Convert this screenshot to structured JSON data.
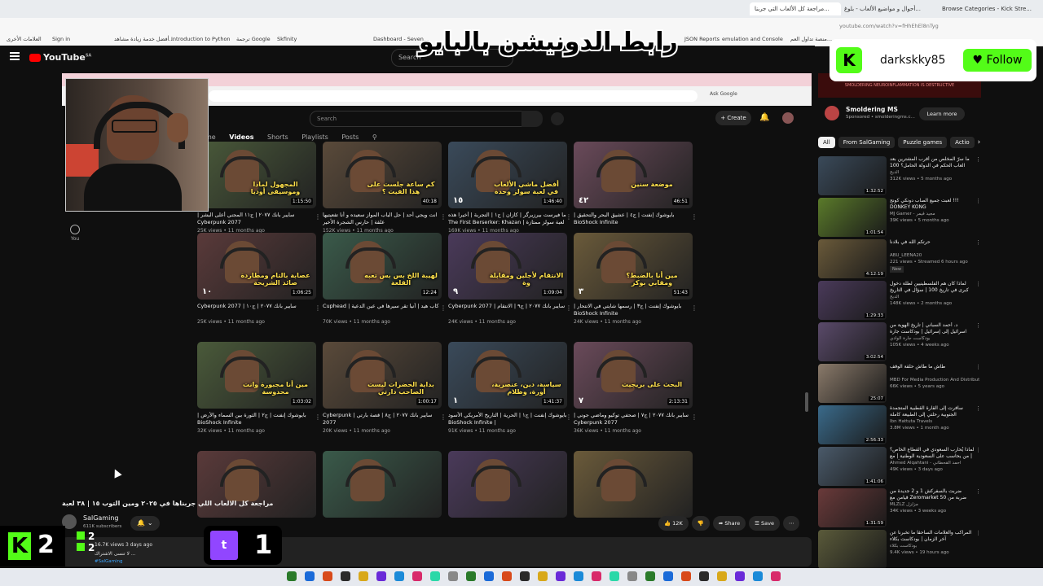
{
  "browser": {
    "tabs": [
      {
        "title": "مراجعة كل الألعاب التي جربنا...",
        "active": false
      },
      {
        "title": "أحوال و مواضيع الألعاب - بلوغ...",
        "active": false
      },
      {
        "title": "Browse Categories - Kick Stre...",
        "active": false
      }
    ],
    "url": "youtube.com/watch?v=fHhEhEl8nTyg",
    "bookmarks": [
      "Sign in",
      "أفضل خدمة زيادة مشاهد...",
      "Introduction to Python",
      "ترجمة Google",
      "Skfinity",
      "...",
      "Dashboard - Seven...",
      "JSON Reports",
      "ترجمة Google",
      "emulation and Console",
      "منصة تداول العم...",
      "كل الإشارات المرجعية",
      "العلامات الأخرى"
    ]
  },
  "youtube": {
    "logo": "YouTube",
    "logo_region": "SA",
    "search_placeholder": "Search"
  },
  "overlay": {
    "banner_text": "رابط الدونيشن بالبايو",
    "kick_username": "darkskky85",
    "kick_follow": "Follow",
    "kick_count": "2",
    "mini_counts": [
      "2",
      "2"
    ],
    "twitch_count": "1",
    "colors": {
      "kick": "#53fc18",
      "twitch": "#9146ff"
    }
  },
  "inner": {
    "ask_label": "Ask Google",
    "search_placeholder": "Search",
    "create_label": "Create",
    "channel_tabs": [
      "me",
      "Videos",
      "Shorts",
      "Playlists",
      "Posts"
    ],
    "active_tab": "Videos",
    "you_label": "You",
    "videos": [
      {
        "title": "سايبر بانك ٢٠٧٧ | ج١١ المجني أعلى البشر | Cyberpunk 2077",
        "meta": "25K views • 11 months ago",
        "caption": "المجهول لماذا وموسيقى أوديا",
        "num": "",
        "duration": "1:15:50"
      },
      {
        "title": "انت ويجي أحد | حل الباب المواز سعيده و أنا تفعيتيها علقة | حارس الشجرة الأخير",
        "meta": "152K views • 11 months ago",
        "caption": "كم ساعة جلست على هذا الفيت ؟",
        "num": "",
        "duration": "40:18"
      },
      {
        "title": "ما فيرست بيرزيرگر | كازان | ج١ | التجربة | أخيرا هذه لعبة سولز ممتازة | The First Berserker: Khazan",
        "meta": "169K views • 11 months ago",
        "caption": "أفضل ماشي الألعاب في لعبة سولز وحدة",
        "num": "١٥",
        "duration": "1:46:40"
      },
      {
        "title": "بايوشوك إنفنت | ج٤ | عشيق البحر والتحقيق | BioShock Infinite",
        "meta": "",
        "caption": "موضعة سنين",
        "num": "٤٢",
        "duration": "46:51"
      },
      {
        "title": "سايبر بانك ٢٠٧٧ | ج١٠ | Cyberpunk 2077",
        "meta": "25K views • 11 months ago",
        "caption": "عصابة بالتام ومطاردة صائد الشريحة",
        "num": "١٠",
        "duration": "1:06:25"
      },
      {
        "title": "كاب هيد | أنيا تقر سيرها في عين الدعية | Cuphead",
        "meta": "70K views • 11 months ago",
        "caption": "لهيبة اللخ بس بس تعبه القلعة",
        "num": "",
        "duration": "12:24"
      },
      {
        "title": "سايبر بانك ٢٠٧٧ | ج٩ | الانتقام | Cyberpunk 2077",
        "meta": "24K views • 11 months ago",
        "caption": "الانتقام لأجلين ومقابلة وة",
        "num": "٩",
        "duration": "1:09:04"
      },
      {
        "title": "بايوشوك إنفنت | ج٣ | رسمها شايتي في الانتحار | BioShock Infinite",
        "meta": "24K views • 11 months ago",
        "caption": "مين أنا بالضبط؟ ومقابي بوكر",
        "num": "٣",
        "duration": "51:43"
      },
      {
        "title": "بايوشوك إنفنت | ج٢ | الثورة بين السماء والأرض | BioShock Infinite",
        "meta": "32K views • 11 months ago",
        "caption": "مين أنا مجبورة وانت محدوسة",
        "num": "",
        "duration": "1:03:02"
      },
      {
        "title": "سايبر بانك ٢٠٧٧ | ج٨ | قصة بارتي | Cyberpunk 2077",
        "meta": "20K views • 11 months ago",
        "caption": "بداية الحضرات ليست الصاحب دارتي",
        "num": "",
        "duration": "1:00:17"
      },
      {
        "title": "بايوشوك إنفنت | ج١ | الحرية | التاريخ الأمريكي الأسود | BioShock Infinite",
        "meta": "91K views • 11 months ago",
        "caption": "سياسة، دين، عنصرية، أورة، وظلام",
        "num": "١",
        "duration": "1:41:37"
      },
      {
        "title": "سايبر بانك ٢٠٧٧ | ج٧ | صحفي توكيو وماضي جوني | Cyberpunk 2077",
        "meta": "36K views • 11 months ago",
        "caption": "البحث على بريجيت",
        "num": "٧",
        "duration": "2:13:31"
      },
      {
        "title": "",
        "meta": "",
        "caption": "",
        "num": "",
        "duration": ""
      },
      {
        "title": "",
        "meta": "",
        "caption": "",
        "num": "",
        "duration": ""
      },
      {
        "title": "",
        "meta": "",
        "caption": "",
        "num": "",
        "duration": ""
      },
      {
        "title": "",
        "meta": "",
        "caption": "",
        "num": "",
        "duration": ""
      }
    ]
  },
  "ad": {
    "image_text": "SMOLDERING NEUROINFLAMMATION IS DESTRUCTIVE",
    "title": "Smoldering MS",
    "sponsor": "Sponsored • smolderingms.c...",
    "learn_more": "Learn more"
  },
  "chips": [
    "All",
    "From SalGaming",
    "Puzzle games",
    "Actio"
  ],
  "sidebar": [
    {
      "title": "ما سرّ المخلص من أقرب المشترين بعد العاب الحكم في الدولة الحامل؟ 100 سؤال في",
      "channel": "الدبح",
      "meta": "312K views • 5 months ago",
      "duration": "1:32:52",
      "badge": "",
      "color": "#3a4a5a"
    },
    {
      "title": "لعبت جميع الصاب دونكي كونج !!! DONKEY KONG",
      "channel": "MJ Gamer - مجيد قيمر",
      "meta": "39K views • 5 months ago",
      "duration": "1:01:54",
      "badge": "",
      "color": "#5a7a2a"
    },
    {
      "title": "حرتكم الله في بلادنا",
      "channel": "ABU_LEENA20",
      "meta": "221 views • Streamed 6 hours ago",
      "duration": "4:12:19",
      "badge": "New",
      "color": "#6a5a3a"
    },
    {
      "title": "لماذا كان هم الفلسطينيين لطلة دخول كبرى في تاريخ 100 | سؤال في التاريخ",
      "channel": "الدبح",
      "meta": "148K views • 2 months ago",
      "duration": "1:29:33",
      "badge": "",
      "color": "#4a3a5a"
    },
    {
      "title": "د. أحمد السباني | تاريخ الهوية من اسرائيل إلى إسرائيل | بودكاست جارة الوادي",
      "channel": "بودكاست جارة الوادي",
      "meta": "105K views • 4 weeks ago",
      "duration": "3:02:54",
      "badge": "",
      "color": "#5a4a6a"
    },
    {
      "title": "طاش ما طاش حلقة الوقف",
      "channel": "MBD For Media Production And Distributi...",
      "meta": "66K views • 5 years ago",
      "duration": "25:07",
      "badge": "",
      "color": "#8a7a6a"
    },
    {
      "title": "سافرت إلى القارة القطبية المتجمدة الجنوبية رحلتي إلى الطبيعة كاملة",
      "channel": "Ibn Hattuta Travels",
      "meta": "3.8M views • 1 month ago",
      "duration": "2:56:33",
      "badge": "",
      "color": "#3a6a8a"
    },
    {
      "title": "لماذا يُحارب السعودي في القطاع الخاص؟ | من يحاسب على السعودية الوطنية | مع أحمد",
      "channel": "Ahmed Alqahtani - أحمد القحطاني",
      "meta": "49K views • 3 days ago",
      "duration": "1:41:06",
      "badge": "",
      "color": "#4a5a6a"
    },
    {
      "title": "ضربت بالسفركش 1 و 2 جديدة من قيامن مع Zeromarket 50 ضربة من خلال",
      "channel": "MLZLZ مزلزل",
      "meta": "34K views • 3 weeks ago",
      "duration": "1:31:59",
      "badge": "",
      "color": "#6a3a3a"
    },
    {
      "title": "المراكب والعلامات الساحقا ما تخبرنا عن آخر الزمان | بودكاست بكلاء",
      "channel": "بودكاست بكلاء",
      "meta": "9.4K views • 19 hours ago",
      "duration": "",
      "badge": "",
      "color": "#5a5a3a"
    }
  ],
  "watch": {
    "title": "مراجعة كل الالعاب اللي جربناها في ٢٠٢٥ ومين التوب ١٥ | ٣٨ لعبة",
    "channel": "SalGaming",
    "subs": "611K subscribers",
    "likes": "12K",
    "share": "Share",
    "save": "Save",
    "views_line": "16.7K views  3 days ago",
    "desc_line": "لا تنسى الاشتراك ...",
    "hashtag": "#SalGaming"
  }
}
